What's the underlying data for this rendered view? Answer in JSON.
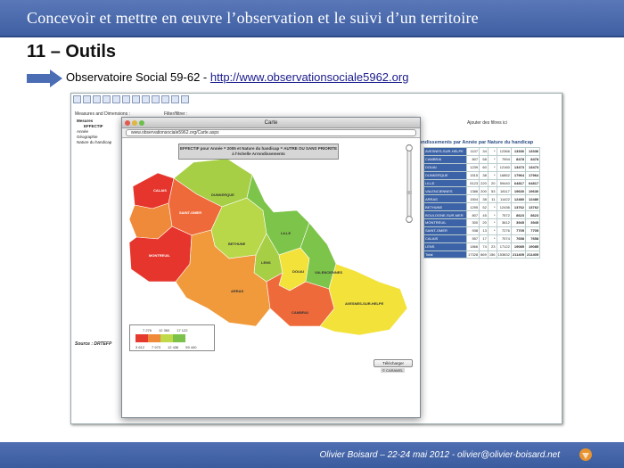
{
  "slide": {
    "title": "Concevoir et mettre en œuvre l’observation et le suivi d’un territoire",
    "heading": "11 – Outils",
    "obs_label": "Observatoire Social 59-62 - ",
    "obs_link": "http://www.observationsociale5962.org",
    "footer": "Olivier Boisard – 22-24 mai 2012 - olivier@olivier-boisard.net"
  },
  "app": {
    "measures_label": "Measures and Dimensions :",
    "filter_label": "Filter/filtrer :",
    "tree": [
      "Mesures",
      "EFFECTIF",
      "Année",
      "Géographie",
      "Nature du handicap"
    ],
    "add_filter": "Ajouter des filtres ici",
    "source": "Source : DRTEFP",
    "table_title": "ondissements par Année par Nature du handicap",
    "rows": [
      [
        "AVESNES-SUR-HELPE",
        "1107",
        "34",
        "*",
        "12366",
        "13336",
        "13336"
      ],
      [
        "CAMBRAI",
        "807",
        "58",
        "*",
        "7994",
        "8478",
        "8478"
      ],
      [
        "DOUAI",
        "1239",
        "60",
        "*",
        "12160",
        "13473",
        "13473"
      ],
      [
        "DUNKERQUE",
        "1515",
        "38",
        "*",
        "16852",
        "17964",
        "17964"
      ],
      [
        "LILLE",
        "5123",
        "220",
        "20",
        "59440",
        "64817",
        "64817"
      ],
      [
        "VALENCIENNES",
        "1386",
        "200",
        "53",
        "18117",
        "19630",
        "19630"
      ],
      [
        "ARRAS",
        "1504",
        "38",
        "11",
        "11422",
        "12480",
        "12480"
      ],
      [
        "BETHUNE",
        "1295",
        "52",
        "*",
        "12436",
        "13762",
        "13762"
      ],
      [
        "BOULOGNE-SUR-MER",
        "807",
        "45",
        "*",
        "7572",
        "8623",
        "8623"
      ],
      [
        "MONTREUIL",
        "300",
        "20",
        "*",
        "3612",
        "3945",
        "3945"
      ],
      [
        "SAINT-OMER",
        "938",
        "13",
        "*",
        "7276",
        "7705",
        "7705"
      ],
      [
        "CALAIS",
        "557",
        "17",
        "*",
        "7074",
        "7658",
        "7658"
      ],
      [
        "LENS",
        "1866",
        "74",
        "23",
        "17122",
        "19085",
        "19085"
      ],
      [
        "Total",
        "17328",
        "869",
        "156",
        "153832",
        "211405",
        "211405"
      ]
    ]
  },
  "map_window": {
    "title": "Carte",
    "url": "www.observationsociale5962.org/Carte.aspx",
    "banner": "EFFECTIF pour Année = 2005 et Nature du handicap = AUTRE OU SANS PRIORITE à l'échelle Arrondissements",
    "download": "Télécharger",
    "attribution": "© CARAMEL",
    "legend_top": [
      "7 276",
      "12 360",
      "17 122"
    ],
    "legend_bottom": [
      "3 612",
      "7 973",
      "12 436",
      "59 440"
    ],
    "legend_colors": [
      "#e53a2e",
      "#ef8a3a",
      "#bfd94a",
      "#7cc24a"
    ],
    "regions": [
      "CALAIS",
      "DUNKERQUE",
      "SAINT-OMER",
      "BETHUNE",
      "LILLE",
      "LENS",
      "DOUAI",
      "VALENCIENNES",
      "MONTREUIL",
      "ARRAS",
      "CAMBRAI",
      "AVESNES-SUR-HELPE"
    ]
  }
}
